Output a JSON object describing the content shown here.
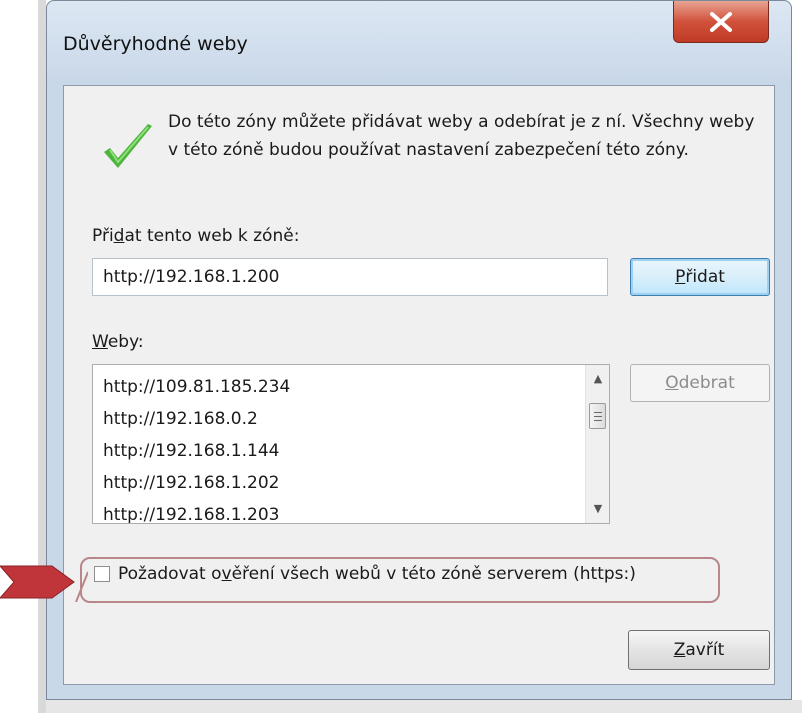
{
  "window": {
    "title": "Důvěryhodné weby"
  },
  "info": {
    "text": "Do této zóny můžete přidávat weby a odebírat je z ní. Všechny weby v této zóně budou používat nastavení zabezpečení této zóny."
  },
  "add": {
    "label_pre": "Při",
    "label_ul": "d",
    "label_post": "at tento web k zóně:",
    "input_value": "http://192.168.1.200",
    "button_ul": "P",
    "button_rest": "řidat"
  },
  "sites": {
    "label_ul": "W",
    "label_rest": "eby:",
    "items": [
      "http://109.81.185.234",
      "http://192.168.0.2",
      "http://192.168.1.144",
      "http://192.168.1.202",
      "http://192.168.1.203"
    ],
    "remove_ul": "O",
    "remove_rest": "debrat"
  },
  "https_check": {
    "label_pre": "Požadovat o",
    "label_ul": "v",
    "label_post": "ěření všech webů v této zóně serverem (https:)",
    "checked": false
  },
  "close": {
    "label_ul": "Z",
    "label_rest": "avřít"
  },
  "colors": {
    "highlight": "#b9878a",
    "arrow": "#c0353a"
  }
}
